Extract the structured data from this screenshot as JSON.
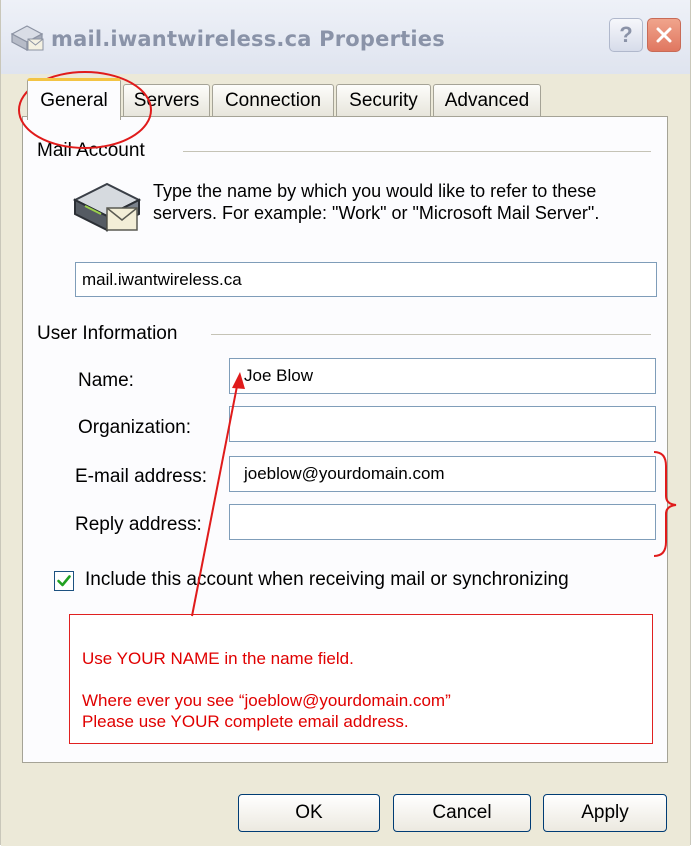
{
  "window": {
    "title": "mail.iwantwireless.ca Properties",
    "help_icon": "help-icon",
    "close_icon": "close-icon"
  },
  "tabs": [
    {
      "label": "General",
      "active": true
    },
    {
      "label": "Servers"
    },
    {
      "label": "Connection"
    },
    {
      "label": "Security"
    },
    {
      "label": "Advanced"
    }
  ],
  "mail_account": {
    "section_label": "Mail Account",
    "icon": "mail-server-icon",
    "description": "Type the name by which you would like to refer to these servers.  For example: \"Work\" or \"Microsoft Mail Server\".",
    "account_name": "mail.iwantwireless.ca"
  },
  "user_info": {
    "section_label": "User Information",
    "name_label": "Name:",
    "name_value": "Joe Blow",
    "organization_label": "Organization:",
    "organization_value": "",
    "email_label": "E-mail address:",
    "email_value": "joeblow@yourdomain.com",
    "reply_label": "Reply address:",
    "reply_value": ""
  },
  "include_account": {
    "label": "Include this account when receiving mail or synchronizing",
    "checked": true
  },
  "annotation": {
    "line1": "Use YOUR NAME in the name field.",
    "line2": "Where ever you see “joeblow@yourdomain.com”",
    "line3": "Please use YOUR complete email address.",
    "color": "#e00000"
  },
  "buttons": {
    "ok": "OK",
    "cancel": "Cancel",
    "apply": "Apply"
  }
}
